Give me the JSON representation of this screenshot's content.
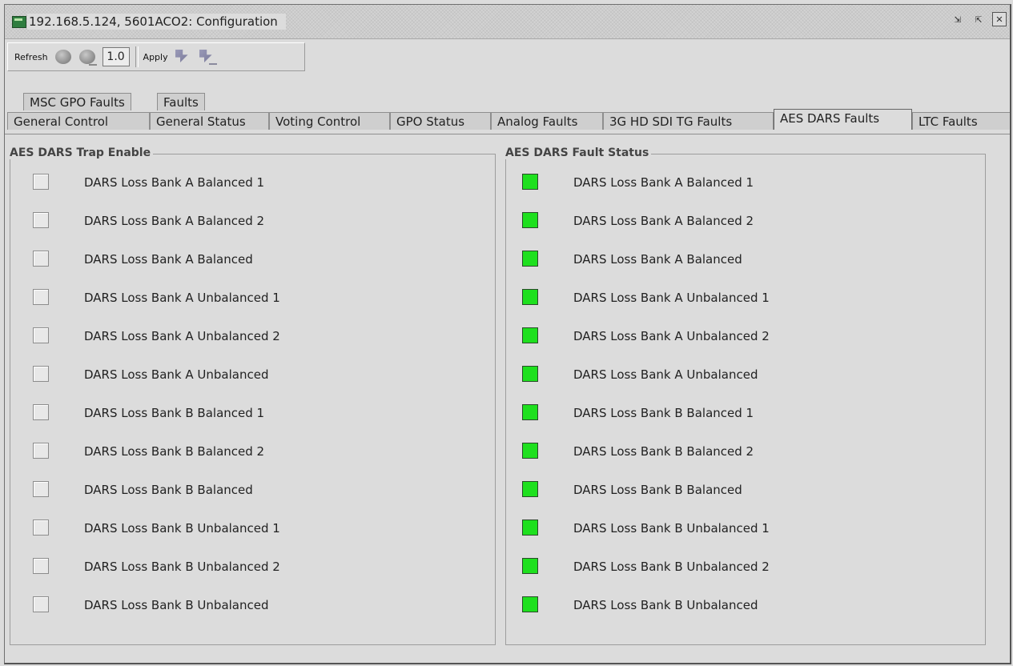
{
  "window": {
    "title": "192.168.5.124, 5601ACO2: Configuration",
    "buttons": [
      "detach-icon",
      "maximize-icon",
      "close-icon"
    ]
  },
  "toolbar": {
    "refresh_label": "Refresh",
    "version_value": "1.0",
    "apply_label": "Apply"
  },
  "tabs": {
    "row1": [
      "MSC GPO Faults",
      "Faults"
    ],
    "row2": [
      "General Control",
      "General Status",
      "Voting Control",
      "GPO Status",
      "Analog Faults",
      "3G HD SDI TG Faults",
      "AES DARS Faults",
      "LTC Faults"
    ],
    "active": "AES DARS Faults"
  },
  "trap_panel": {
    "title": "AES DARS Trap Enable",
    "items": [
      {
        "label": "DARS Loss Bank A Balanced 1",
        "checked": false
      },
      {
        "label": "DARS Loss Bank A Balanced 2",
        "checked": false
      },
      {
        "label": "DARS Loss Bank A Balanced",
        "checked": false
      },
      {
        "label": "DARS Loss Bank A Unbalanced 1",
        "checked": false
      },
      {
        "label": "DARS Loss Bank A Unbalanced 2",
        "checked": false
      },
      {
        "label": "DARS Loss Bank A Unbalanced",
        "checked": false
      },
      {
        "label": "DARS Loss Bank B Balanced 1",
        "checked": false
      },
      {
        "label": "DARS Loss Bank B Balanced 2",
        "checked": false
      },
      {
        "label": "DARS Loss Bank B Balanced",
        "checked": false
      },
      {
        "label": "DARS Loss Bank B Unbalanced 1",
        "checked": false
      },
      {
        "label": "DARS Loss Bank B Unbalanced 2",
        "checked": false
      },
      {
        "label": "DARS Loss Bank B Unbalanced",
        "checked": false
      }
    ]
  },
  "status_panel": {
    "title": "AES DARS Fault Status",
    "status_color": "#1ee01e",
    "items": [
      {
        "label": "DARS Loss Bank A Balanced 1",
        "status": "ok"
      },
      {
        "label": "DARS Loss Bank A Balanced 2",
        "status": "ok"
      },
      {
        "label": "DARS Loss Bank A Balanced",
        "status": "ok"
      },
      {
        "label": "DARS Loss Bank A Unbalanced 1",
        "status": "ok"
      },
      {
        "label": "DARS Loss Bank A Unbalanced 2",
        "status": "ok"
      },
      {
        "label": "DARS Loss Bank A Unbalanced",
        "status": "ok"
      },
      {
        "label": "DARS Loss Bank B Balanced 1",
        "status": "ok"
      },
      {
        "label": "DARS Loss Bank B Balanced 2",
        "status": "ok"
      },
      {
        "label": "DARS Loss Bank B Balanced",
        "status": "ok"
      },
      {
        "label": "DARS Loss Bank B Unbalanced 1",
        "status": "ok"
      },
      {
        "label": "DARS Loss Bank B Unbalanced 2",
        "status": "ok"
      },
      {
        "label": "DARS Loss Bank B Unbalanced",
        "status": "ok"
      }
    ]
  }
}
